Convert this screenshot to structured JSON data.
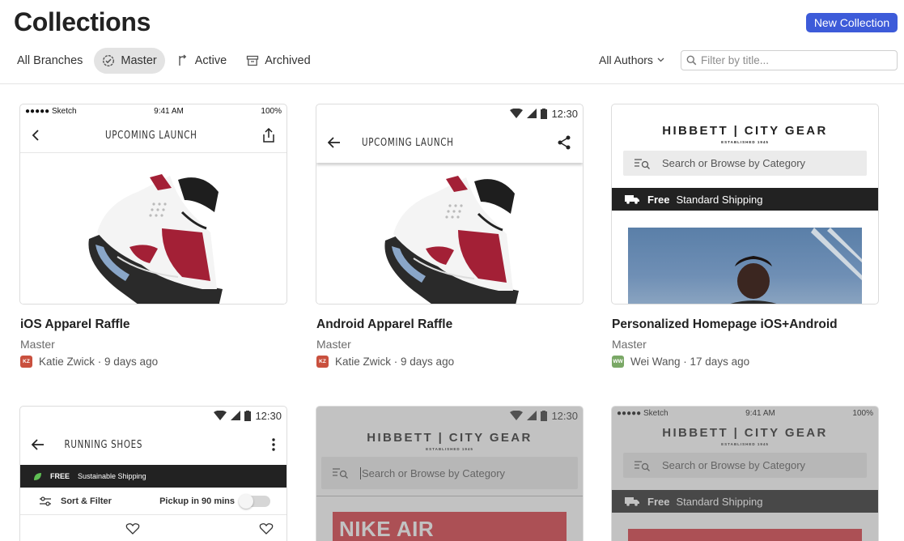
{
  "header": {
    "title": "Collections",
    "new_button": "New Collection"
  },
  "tabs": [
    {
      "label": "All Branches",
      "icon": "none",
      "active": false
    },
    {
      "label": "Master",
      "icon": "branch-check-icon",
      "active": true
    },
    {
      "label": "Active",
      "icon": "branch-active-icon",
      "active": false
    },
    {
      "label": "Archived",
      "icon": "archive-icon",
      "active": false
    }
  ],
  "filters": {
    "authors_label": "All Authors",
    "search_placeholder": "Filter by title..."
  },
  "cards": [
    {
      "title": "iOS Apparel Raffle",
      "branch": "Master",
      "author": "Katie Zwick",
      "initials": "KZ",
      "avatar_color": "#c9503e",
      "time": "9 days ago"
    },
    {
      "title": "Android Apparel Raffle",
      "branch": "Master",
      "author": "Katie Zwick",
      "initials": "KZ",
      "avatar_color": "#c9503e",
      "time": "9 days ago"
    },
    {
      "title": "Personalized Homepage iOS+Android",
      "branch": "Master",
      "author": "Wei Wang",
      "initials": "WW",
      "avatar_color": "#7aa866",
      "time": "17 days ago"
    }
  ],
  "mockups": {
    "ios_status": {
      "carrier": "●●●●● Sketch",
      "time": "9:41 AM",
      "battery": "100%"
    },
    "android_time": "12:30",
    "upcoming_launch": "UPCOMING LAUNCH",
    "running_shoes": "RUNNING SHOES",
    "free_label": "FREE",
    "sustainable_shipping": "Sustainable Shipping",
    "sort_filter": "Sort & Filter",
    "pickup": "Pickup in 90 mins",
    "hibbett_logo": "HIBBETT | CITY GEAR",
    "hibbett_established": "ESTABLISHED 1945",
    "search_category": "Search or Browse by Category",
    "ship_free": "Free",
    "ship_standard": "Standard Shipping",
    "nike_air": "NIKE AIR"
  },
  "colors": {
    "accent": "#3d5bd9",
    "active_tab_bg": "#e3e3e3",
    "sneaker_red": "#a32036"
  }
}
